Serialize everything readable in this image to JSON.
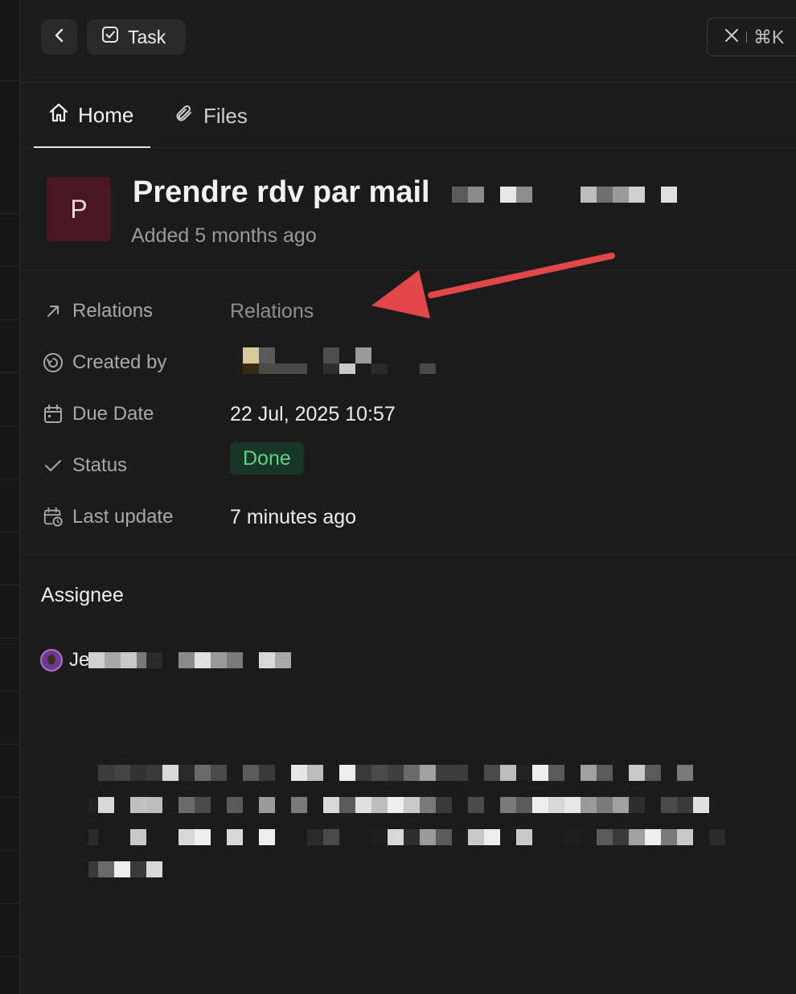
{
  "topbar": {
    "back_icon": "chevron-left-icon",
    "task_icon": "checkbox-icon",
    "task_label": "Task",
    "close_shortcut": "⌘K"
  },
  "tabs": [
    {
      "label": "Home",
      "icon": "home-icon",
      "active": true
    },
    {
      "label": "Files",
      "icon": "paperclip-icon",
      "active": false
    }
  ],
  "record": {
    "avatar_letter": "P",
    "title": "Prendre rdv par mail",
    "subtitle": "Added 5 months ago"
  },
  "properties": {
    "relations": {
      "label": "Relations",
      "value": "Relations",
      "icon": "arrow-up-right-icon"
    },
    "created_by": {
      "label": "Created by",
      "icon": "user-circle-icon"
    },
    "due_date": {
      "label": "Due Date",
      "value": "22 Jul, 2025 10:57",
      "icon": "calendar-icon"
    },
    "status": {
      "label": "Status",
      "value": "Done",
      "icon": "check-icon"
    },
    "last_update": {
      "label": "Last update",
      "value": "7 minutes ago",
      "icon": "calendar-clock-icon"
    }
  },
  "assignee": {
    "heading": "Assignee",
    "name_prefix": "Je"
  },
  "colors": {
    "background": "#1b1b1b",
    "avatar_bg": "#4a1720",
    "status_bg": "#173626",
    "status_text": "#5fd18a",
    "annotation_arrow": "#e2474a"
  }
}
